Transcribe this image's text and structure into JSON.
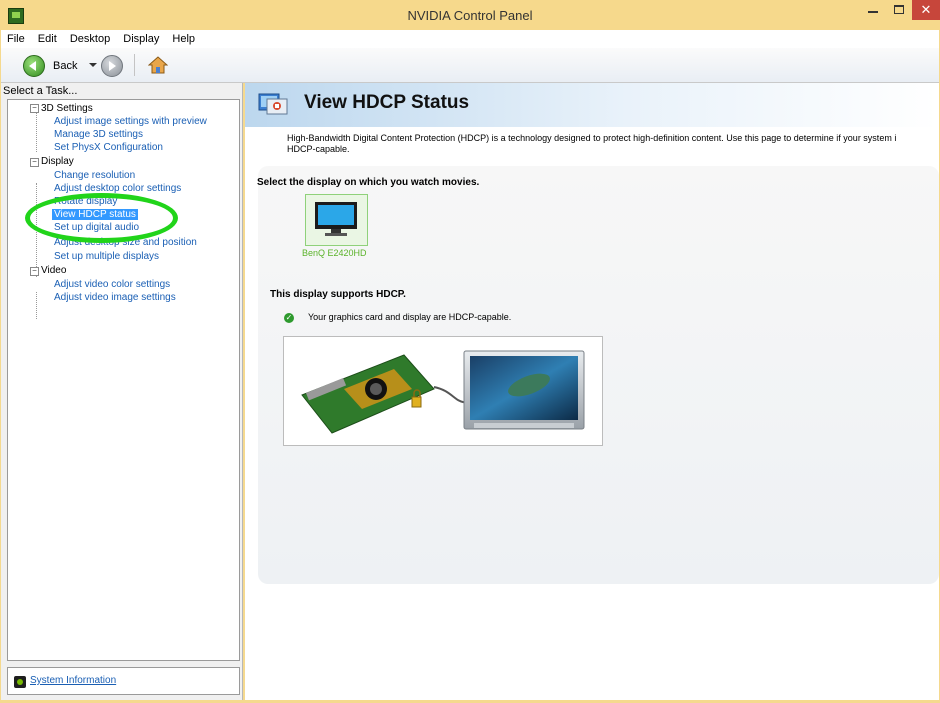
{
  "window": {
    "title": "NVIDIA Control Panel"
  },
  "menu": [
    "File",
    "Edit",
    "Desktop",
    "Display",
    "Help"
  ],
  "toolbar": {
    "back_label": "Back"
  },
  "left_pane": {
    "task_label": "Select a Task...",
    "categories": [
      {
        "label": "3D Settings",
        "items": [
          "Adjust image settings with preview",
          "Manage 3D settings",
          "Set PhysX Configuration"
        ]
      },
      {
        "label": "Display",
        "items": [
          "Change resolution",
          "Adjust desktop color settings",
          "Rotate display",
          "View HDCP status",
          "Set up digital audio",
          "Adjust desktop size and position",
          "Set up multiple displays"
        ]
      },
      {
        "label": "Video",
        "items": [
          "Adjust video color settings",
          "Adjust video image settings"
        ]
      }
    ],
    "selected_item": "View HDCP status",
    "system_info": "System Information"
  },
  "page": {
    "title": "View HDCP Status",
    "description_line1": "High-Bandwidth Digital Content Protection (HDCP) is a technology designed to protect high-definition content. Use this page to determine if your system i",
    "description_line2": "HDCP-capable.",
    "select_display_heading": "Select the display on which you watch movies.",
    "display_name": "BenQ E2420HD",
    "supports_heading": "This display supports HDCP.",
    "status_message": "Your graphics card and display are HDCP-capable."
  },
  "colors": {
    "title_bar": "#f6d98c",
    "link": "#1a5fb4",
    "selection": "#3399ff",
    "highlight_ring": "#21d41a",
    "nvidia_green": "#76b900"
  }
}
